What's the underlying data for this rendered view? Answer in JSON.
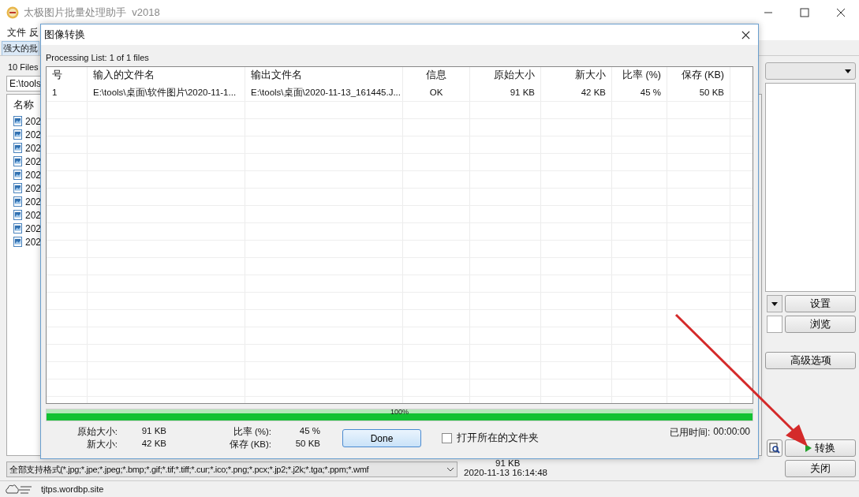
{
  "window": {
    "title": "太极图片批量处理助手  v2018"
  },
  "menu": [
    "文件",
    "反"
  ],
  "tab": {
    "label": "强大的批"
  },
  "file_count": "10 Files",
  "path_field": {
    "value": "E:\\tools"
  },
  "file_list": {
    "header": "名称",
    "items": [
      "202",
      "202",
      "202",
      "202",
      "202",
      "202",
      "202",
      "202",
      "202",
      "202"
    ]
  },
  "format_filter": {
    "value": "全部支持格式(*.jpg;*.jpe;*.jpeg;*.bmp;*.gif;*.tif;*.tiff;*.cur;*.ico;*.png;*.pcx;*.jp2;*.j2k;*.tga;*.ppm;*.wmf"
  },
  "file_info": {
    "size": "91 KB",
    "date": "2020-11-13 16:14:48"
  },
  "settings_button": "设置",
  "browse_button": "浏览",
  "advanced_button": "高级选项",
  "convert_button": "转换",
  "close_button": "关闭",
  "status_bar": {
    "text": "tjtps.wordbp.site"
  },
  "dialog": {
    "title": "图像转换",
    "list_caption": "Processing List: 1 of 1 files",
    "columns": [
      "号",
      "输入的文件名",
      "输出文件名",
      "信息",
      "原始大小",
      "新大小",
      "比率 (%)",
      "保存 (KB)"
    ],
    "rows": [
      [
        "1",
        "E:\\tools\\桌面\\软件图片\\2020-11-1...",
        "E:\\tools\\桌面\\2020-11-13_161445.J...",
        "OK",
        "91 KB",
        "42 KB",
        "45 %",
        "50 KB"
      ]
    ],
    "progress": {
      "level": 1,
      "label": "100%"
    },
    "stats": [
      {
        "label": "原始大小:",
        "value": "91 KB"
      },
      {
        "label": "新大小:",
        "value": "42 KB"
      },
      {
        "label": "比率 (%):",
        "value": "45 %"
      },
      {
        "label": "保存 (KB):",
        "value": "50 KB"
      }
    ],
    "done_button": "Done",
    "open_folder": {
      "label": "打开所在的文件夹",
      "checked": false
    },
    "elapsed": {
      "label": "已用时间:",
      "value": "00:00:00"
    }
  }
}
